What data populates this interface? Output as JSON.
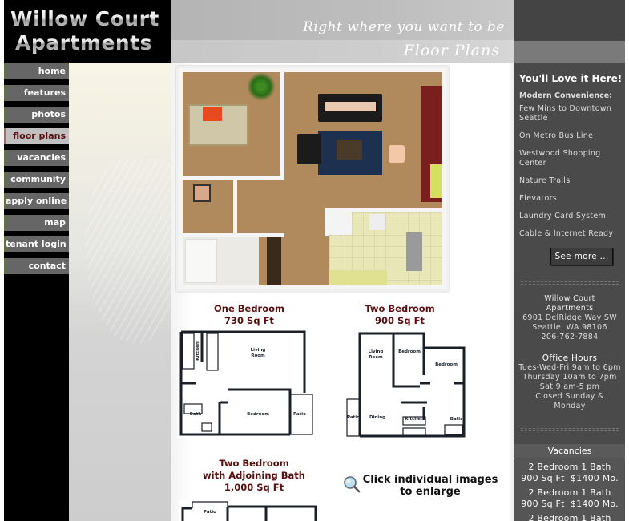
{
  "site": {
    "logo_line1": "Willow Court",
    "logo_line2": "Apartments",
    "tagline": "Right where you want to be",
    "page_heading": "Floor Plans"
  },
  "nav": {
    "items": [
      {
        "label": "home",
        "active": false
      },
      {
        "label": "features",
        "active": false
      },
      {
        "label": "photos",
        "active": false
      },
      {
        "label": "floor plans",
        "active": true
      },
      {
        "label": "vacancies",
        "active": false
      },
      {
        "label": "community",
        "active": false
      },
      {
        "label": "apply online",
        "active": false
      },
      {
        "label": "map",
        "active": false
      },
      {
        "label": "tenant login",
        "active": false
      },
      {
        "label": "contact",
        "active": false
      }
    ]
  },
  "main": {
    "plans": [
      {
        "title": "One Bedroom",
        "size": "730 Sq Ft",
        "rooms": [
          "Living Room",
          "Kitchen",
          "Bath",
          "Bedroom",
          "Patio"
        ]
      },
      {
        "title": "Two Bedroom",
        "size": "900 Sq Ft",
        "rooms": [
          "Living Room",
          "Bedroom",
          "Bedroom",
          "Patio",
          "Dining",
          "Kitchen",
          "Bath"
        ]
      },
      {
        "title": "Two Bedroom",
        "title2": "with Adjoining Bath",
        "size": "1,000 Sq Ft",
        "rooms": [
          "Patio"
        ]
      }
    ],
    "enlarge_hint_line1": "Click individual images",
    "enlarge_hint_line2": "to enlarge",
    "icons": {
      "magnifier": "magnifier-icon"
    }
  },
  "sidebar": {
    "title": "You'll Love it Here!",
    "subtitle": "Modern Convenience:",
    "features": [
      "Few Mins to Downtown Seattle",
      "On Metro Bus Line",
      "Westwood Shopping Center",
      "Nature Trails",
      "Elevators",
      "Laundry Card System",
      "Cable & Internet Ready"
    ],
    "see_more_label": "See more ...",
    "address": {
      "name_line1": "Willow Court",
      "name_line2": "Apartments",
      "street": "6901 DelRidge Way SW",
      "city": "Seattle, WA 98106",
      "phone": "206-762-7884"
    },
    "office_hours": {
      "title": "Office Hours",
      "lines": [
        "Tues-Wed-Fri 9am to 6pm",
        "Thursday 10am to 7pm",
        "Sat 9 am-5 pm",
        "Closed Sunday & Monday"
      ]
    },
    "vacancies": {
      "title": "Vacancies",
      "items": [
        {
          "line1": "2 Bedroom 1 Bath",
          "line2": "900 Sq Ft  $1400 Mo."
        },
        {
          "line1": "2 Bedroom 1 Bath",
          "line2": "900 Sq Ft  $1400 Mo."
        },
        {
          "line1": "2 Bedroom 1 Bath",
          "line2": ""
        }
      ]
    }
  },
  "colors": {
    "nav_bg": "#666666",
    "nav_active_bg": "#c0c0c0",
    "nav_active_text": "#5a0f0f",
    "caption_text": "#5a0f0f",
    "sidebar_bg": "#4a4a4a"
  }
}
